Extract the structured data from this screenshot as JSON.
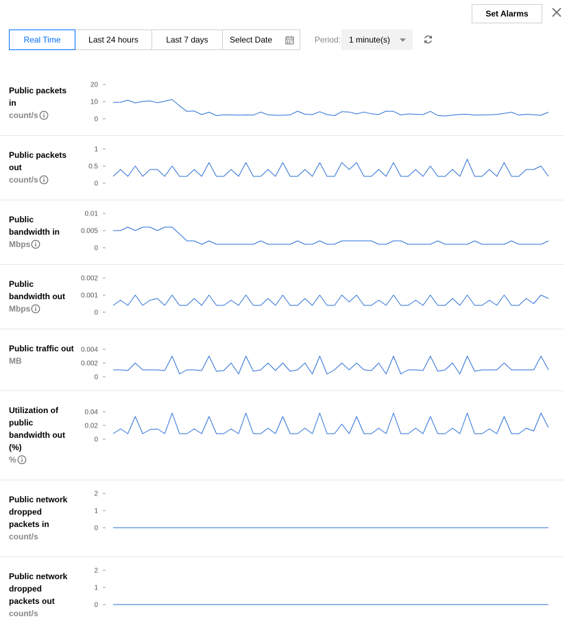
{
  "header": {
    "set_alarms_label": "Set Alarms",
    "close_icon": "close-icon"
  },
  "toolbar": {
    "tabs": [
      {
        "label": "Real Time",
        "active": true
      },
      {
        "label": "Last 24 hours",
        "active": false
      },
      {
        "label": "Last 7 days",
        "active": false
      }
    ],
    "date_picker_label": "Select Date",
    "date_picker_icon": "calendar-icon",
    "period_label": "Period:",
    "period_value": "1 minute(s)",
    "refresh_icon": "refresh-icon"
  },
  "colors": {
    "accent": "#006eff",
    "series_line": "#2b6fd6",
    "unit_text": "#888888",
    "separator": "#e6e6e6"
  },
  "metrics": [
    {
      "title": "Public packets in",
      "unit": "count/s",
      "info": true
    },
    {
      "title": "Public packets out",
      "unit": "count/s",
      "info": true
    },
    {
      "title": "Public bandwidth in",
      "unit": "Mbps",
      "info": true
    },
    {
      "title": "Public bandwidth out",
      "unit": "Mbps",
      "info": true
    },
    {
      "title": "Public traffic out",
      "unit": "MB",
      "info": false
    },
    {
      "title": "Utilization of public bandwidth out (%)",
      "unit": "%",
      "info": true
    },
    {
      "title": "Public network dropped packets in",
      "unit": "count/s",
      "info": false
    },
    {
      "title": "Public network dropped packets out",
      "unit": "count/s",
      "info": false
    }
  ],
  "chart_data": [
    {
      "type": "line",
      "ticks": [
        "0",
        "10",
        "20"
      ],
      "ylim": [
        0,
        20
      ],
      "series": [
        {
          "values": [
            9.5,
            9.6,
            10.8,
            9.2,
            10.1,
            10.4,
            9.3,
            10.2,
            11.2,
            7.5,
            4.3,
            4.5,
            2.4,
            3.8,
            1.8,
            2.3,
            2.2,
            2.1,
            2.2,
            2.1,
            3.9,
            2.3,
            2.0,
            2.0,
            2.3,
            4.4,
            2.6,
            2.4,
            4.1,
            2.4,
            1.8,
            4.1,
            3.9,
            2.8,
            3.9,
            2.9,
            2.5,
            4.4,
            4.3,
            2.2,
            2.8,
            2.6,
            2.4,
            4.3,
            1.9,
            1.6,
            2.1,
            2.5,
            2.6,
            2.1,
            2.2,
            2.3,
            2.5,
            3.1,
            3.8,
            2.1,
            2.6,
            2.3,
            2.0,
            3.8
          ]
        }
      ]
    },
    {
      "type": "line",
      "ticks": [
        "0",
        "0.5",
        "1"
      ],
      "ylim": [
        0,
        1
      ],
      "series": [
        {
          "values": [
            0.2,
            0.4,
            0.2,
            0.5,
            0.2,
            0.4,
            0.4,
            0.2,
            0.5,
            0.2,
            0.2,
            0.4,
            0.2,
            0.6,
            0.2,
            0.2,
            0.4,
            0.2,
            0.6,
            0.2,
            0.2,
            0.4,
            0.2,
            0.6,
            0.2,
            0.2,
            0.4,
            0.2,
            0.6,
            0.2,
            0.2,
            0.6,
            0.4,
            0.6,
            0.2,
            0.2,
            0.4,
            0.2,
            0.6,
            0.2,
            0.2,
            0.4,
            0.2,
            0.5,
            0.2,
            0.2,
            0.4,
            0.2,
            0.7,
            0.2,
            0.2,
            0.4,
            0.2,
            0.6,
            0.2,
            0.2,
            0.4,
            0.4,
            0.5,
            0.2
          ]
        }
      ]
    },
    {
      "type": "line",
      "ticks": [
        "0",
        "0.005",
        "0.01"
      ],
      "ylim": [
        0,
        0.01
      ],
      "series": [
        {
          "values": [
            0.005,
            0.005,
            0.006,
            0.005,
            0.006,
            0.006,
            0.005,
            0.006,
            0.006,
            0.004,
            0.002,
            0.002,
            0.001,
            0.002,
            0.001,
            0.001,
            0.001,
            0.001,
            0.001,
            0.001,
            0.002,
            0.001,
            0.001,
            0.001,
            0.001,
            0.002,
            0.001,
            0.001,
            0.002,
            0.001,
            0.001,
            0.002,
            0.002,
            0.002,
            0.002,
            0.002,
            0.001,
            0.001,
            0.002,
            0.002,
            0.001,
            0.001,
            0.001,
            0.001,
            0.002,
            0.001,
            0.001,
            0.001,
            0.001,
            0.002,
            0.001,
            0.001,
            0.001,
            0.001,
            0.002,
            0.001,
            0.001,
            0.001,
            0.001,
            0.002
          ]
        }
      ]
    },
    {
      "type": "line",
      "ticks": [
        "0",
        "0.001",
        "0.002"
      ],
      "ylim": [
        0,
        0.002
      ],
      "series": [
        {
          "values": [
            0.0004,
            0.0007,
            0.0004,
            0.001,
            0.0004,
            0.0007,
            0.0008,
            0.0004,
            0.001,
            0.0004,
            0.0004,
            0.0008,
            0.0004,
            0.001,
            0.0004,
            0.0004,
            0.0007,
            0.0004,
            0.001,
            0.0004,
            0.0004,
            0.0008,
            0.0004,
            0.001,
            0.0004,
            0.0004,
            0.0008,
            0.0004,
            0.001,
            0.0004,
            0.0004,
            0.001,
            0.0006,
            0.001,
            0.0004,
            0.0004,
            0.0007,
            0.0004,
            0.001,
            0.0004,
            0.0004,
            0.0007,
            0.0004,
            0.001,
            0.0004,
            0.0004,
            0.0008,
            0.0004,
            0.001,
            0.0004,
            0.0004,
            0.0007,
            0.0004,
            0.001,
            0.0004,
            0.0004,
            0.0008,
            0.0005,
            0.001,
            0.0008
          ]
        }
      ]
    },
    {
      "type": "line",
      "ticks": [
        "0",
        "0.002",
        "0.004"
      ],
      "ylim": [
        0,
        0.004
      ],
      "series": [
        {
          "values": [
            0.001,
            0.001,
            0.0009,
            0.002,
            0.001,
            0.001,
            0.001,
            0.0009,
            0.003,
            0.0004,
            0.001,
            0.001,
            0.0009,
            0.003,
            0.0008,
            0.0009,
            0.002,
            0.0004,
            0.003,
            0.0008,
            0.001,
            0.002,
            0.0009,
            0.002,
            0.0008,
            0.001,
            0.002,
            0.0004,
            0.003,
            0.0004,
            0.001,
            0.002,
            0.001,
            0.002,
            0.001,
            0.0009,
            0.002,
            0.0004,
            0.003,
            0.0004,
            0.001,
            0.001,
            0.0009,
            0.003,
            0.0008,
            0.001,
            0.002,
            0.0004,
            0.003,
            0.0008,
            0.001,
            0.001,
            0.001,
            0.002,
            0.001,
            0.001,
            0.001,
            0.001,
            0.003,
            0.001
          ]
        }
      ]
    },
    {
      "type": "line",
      "ticks": [
        "0",
        "0.02",
        "0.04"
      ],
      "ylim": [
        0,
        0.04
      ],
      "series": [
        {
          "values": [
            0.008,
            0.015,
            0.008,
            0.033,
            0.008,
            0.014,
            0.015,
            0.008,
            0.038,
            0.008,
            0.008,
            0.015,
            0.008,
            0.033,
            0.008,
            0.008,
            0.015,
            0.008,
            0.038,
            0.008,
            0.008,
            0.016,
            0.008,
            0.033,
            0.008,
            0.008,
            0.016,
            0.008,
            0.038,
            0.008,
            0.008,
            0.022,
            0.008,
            0.033,
            0.008,
            0.008,
            0.016,
            0.008,
            0.038,
            0.008,
            0.008,
            0.016,
            0.008,
            0.033,
            0.008,
            0.008,
            0.016,
            0.008,
            0.038,
            0.008,
            0.008,
            0.015,
            0.008,
            0.033,
            0.008,
            0.008,
            0.016,
            0.012,
            0.038,
            0.017
          ]
        }
      ]
    },
    {
      "type": "line",
      "ticks": [
        "0",
        "1",
        "2"
      ],
      "ylim": [
        0,
        2
      ],
      "series": [
        {
          "values": [
            0,
            0,
            0,
            0,
            0,
            0,
            0,
            0,
            0,
            0,
            0,
            0,
            0,
            0,
            0,
            0,
            0,
            0,
            0,
            0,
            0,
            0,
            0,
            0,
            0,
            0,
            0,
            0,
            0,
            0,
            0,
            0,
            0,
            0,
            0,
            0,
            0,
            0,
            0,
            0,
            0,
            0,
            0,
            0,
            0,
            0,
            0,
            0,
            0,
            0,
            0,
            0,
            0,
            0,
            0,
            0,
            0,
            0,
            0,
            0
          ]
        }
      ]
    },
    {
      "type": "line",
      "ticks": [
        "0",
        "1",
        "2"
      ],
      "ylim": [
        0,
        2
      ],
      "series": [
        {
          "values": [
            0,
            0,
            0,
            0,
            0,
            0,
            0,
            0,
            0,
            0,
            0,
            0,
            0,
            0,
            0,
            0,
            0,
            0,
            0,
            0,
            0,
            0,
            0,
            0,
            0,
            0,
            0,
            0,
            0,
            0,
            0,
            0,
            0,
            0,
            0,
            0,
            0,
            0,
            0,
            0,
            0,
            0,
            0,
            0,
            0,
            0,
            0,
            0,
            0,
            0,
            0,
            0,
            0,
            0,
            0,
            0,
            0,
            0,
            0,
            0
          ]
        }
      ]
    }
  ]
}
